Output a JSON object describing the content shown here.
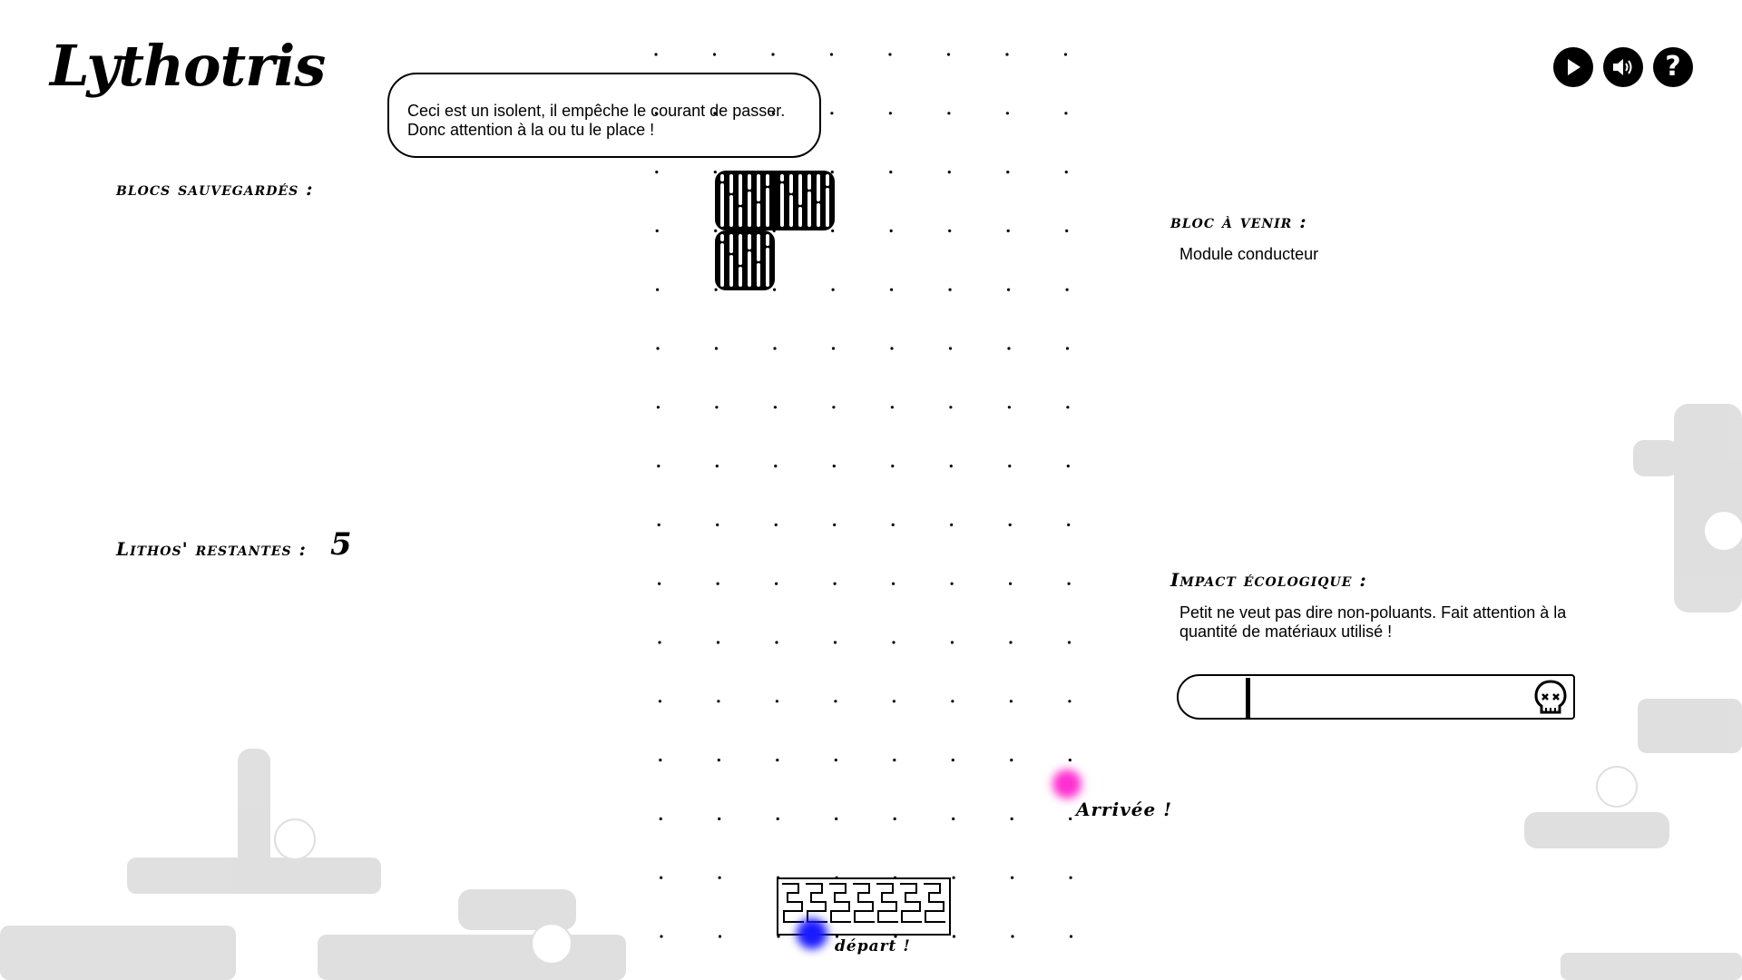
{
  "app": {
    "title": "Lythotris"
  },
  "toolbar": {
    "play_icon": "play-icon",
    "sound_icon": "sound-icon",
    "help_icon": "question-icon",
    "help_glyph": "?"
  },
  "tooltip": {
    "line1": "Ceci est un isolent, il empêche le courant de passer.",
    "line2": "Donc attention à la ou tu le place !"
  },
  "left_panel": {
    "saved_blocks_label": "blocs sauvegardés :",
    "lithos_label": "Lithos' restantes :",
    "lithos_count": "5"
  },
  "right_panel": {
    "next_block_label": "bloc à venir :",
    "next_block_value": "Module conducteur",
    "impact_label": "Impact écologique :",
    "impact_text": "Petit ne veut pas dire non-poluants. Fait attention à la quantité de matériaux utilisé !",
    "impact_level": 0.17,
    "impact_icon": "skull-icon"
  },
  "board": {
    "arrival_label": "Arrivée !",
    "start_label": "départ !",
    "arrival_color": "#ff2fd0",
    "start_color": "#1a1aff"
  }
}
